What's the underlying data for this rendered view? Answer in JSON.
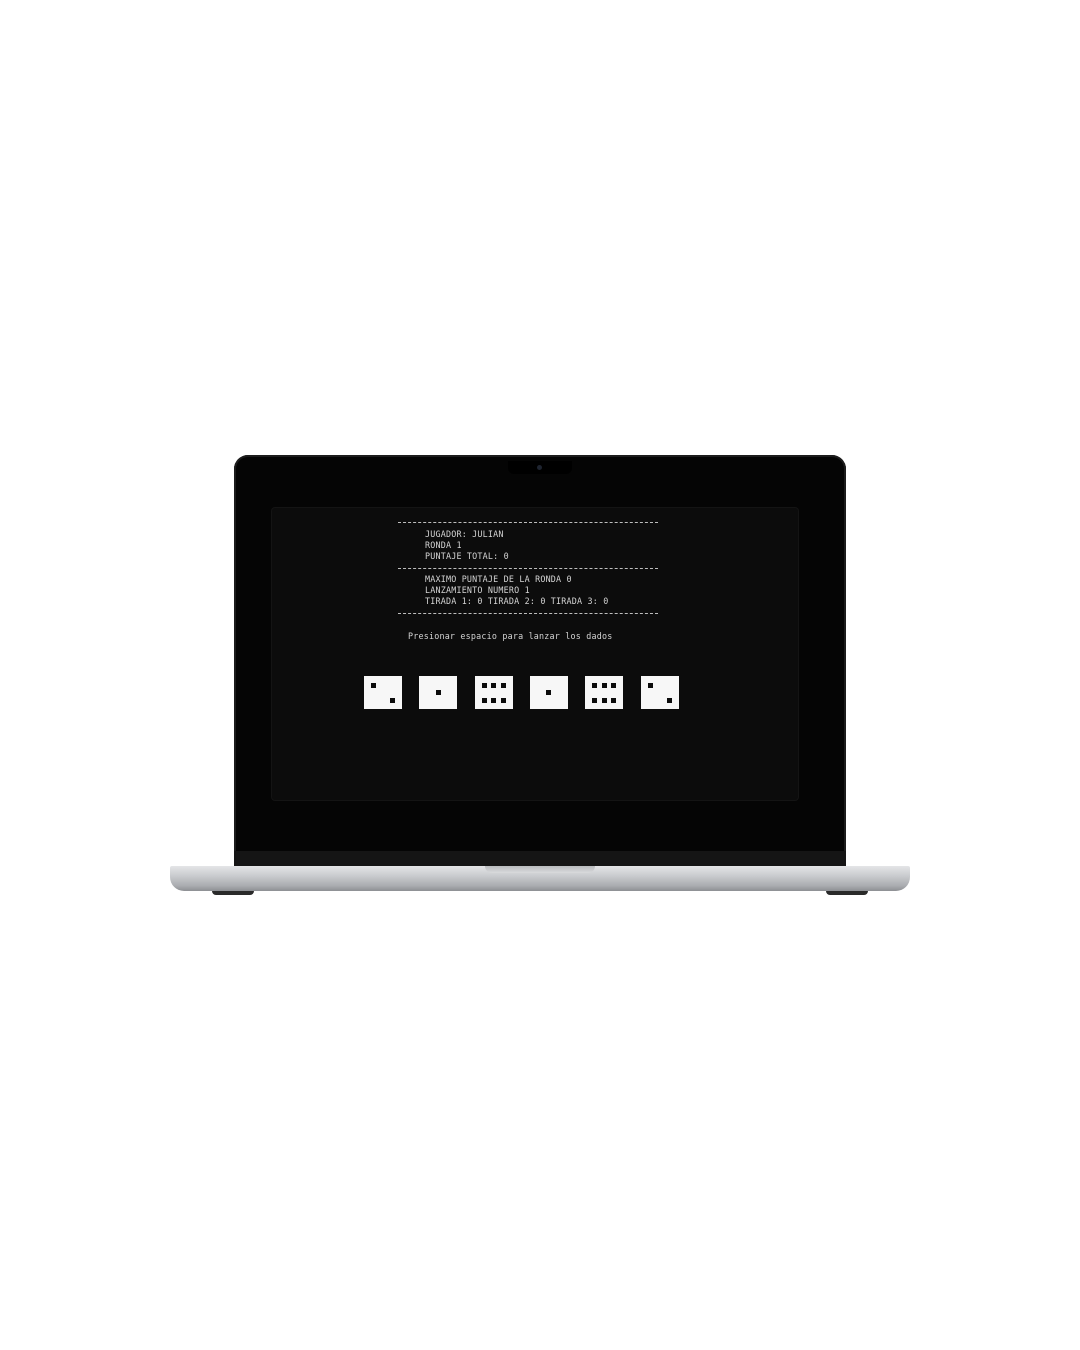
{
  "console": {
    "player_line": "JUGADOR: JULIAN",
    "round_line": "RONDA 1",
    "total_score_line": "PUNTAJE TOTAL: 0",
    "max_round_score_line": "MAXIMO PUNTAJE DE LA RONDA 0",
    "throw_number_line": "LANZAMIENTO NUMERO 1",
    "rolls_line": "TIRADA 1: 0 TIRADA 2: 0 TIRADA 3: 0",
    "prompt": "Presionar espacio para lanzar los dados"
  },
  "dice": [
    {
      "value": 2
    },
    {
      "value": 1
    },
    {
      "value": 6
    },
    {
      "value": 1
    },
    {
      "value": 6
    },
    {
      "value": 2
    }
  ],
  "colors": {
    "console_bg": "#0c0c0c",
    "console_text": "#d4d4d4",
    "die_face": "#f7f7f7",
    "pip": "#0c0c0c"
  }
}
